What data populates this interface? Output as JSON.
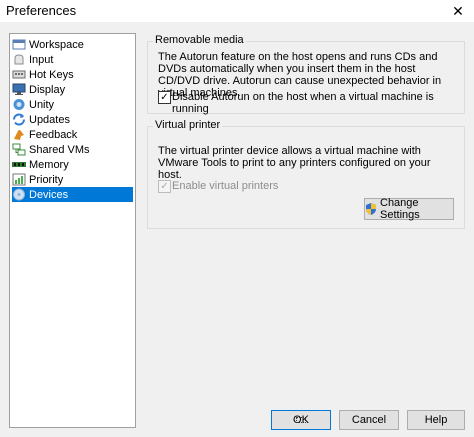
{
  "window": {
    "title": "Preferences",
    "close_glyph": "✕"
  },
  "nav": {
    "items": [
      {
        "label": "Workspace",
        "icon": "workspace-icon",
        "color": "#5a7fb5"
      },
      {
        "label": "Input",
        "icon": "input-icon",
        "color": "#8c8c8c"
      },
      {
        "label": "Hot Keys",
        "icon": "hot-keys-icon",
        "color": "#6b6b6b"
      },
      {
        "label": "Display",
        "icon": "display-icon",
        "color": "#3a6fb0"
      },
      {
        "label": "Unity",
        "icon": "unity-icon",
        "color": "#4a90d9"
      },
      {
        "label": "Updates",
        "icon": "updates-icon",
        "color": "#2e7bd6"
      },
      {
        "label": "Feedback",
        "icon": "feedback-icon",
        "color": "#e08a1e"
      },
      {
        "label": "Shared VMs",
        "icon": "shared-vms-icon",
        "color": "#3c8c3c"
      },
      {
        "label": "Memory",
        "icon": "memory-icon",
        "color": "#2e7d32"
      },
      {
        "label": "Priority",
        "icon": "priority-icon",
        "color": "#4caf50"
      },
      {
        "label": "Devices",
        "icon": "devices-icon",
        "color": "#8fb3d9"
      }
    ],
    "selected": "Devices"
  },
  "removable_media": {
    "title": "Removable media",
    "description": "The Autorun feature on the host opens and runs CDs and DVDs automatically when you insert them in the host CD/DVD drive. Autorun can cause unexpected behavior in virtual machines.",
    "checkbox_label": "Disable Autorun on the host when a virtual machine is running",
    "checked": true
  },
  "virtual_printer": {
    "title": "Virtual printer",
    "description": "The virtual printer device allows a virtual machine with VMware Tools to print to any printers configured on your host.",
    "checkbox_label": "Enable virtual printers",
    "checked": true,
    "change_settings_label": "Change Settings"
  },
  "buttons": {
    "ok": "OK",
    "cancel": "Cancel",
    "help": "Help"
  },
  "check_glyph": "✓"
}
